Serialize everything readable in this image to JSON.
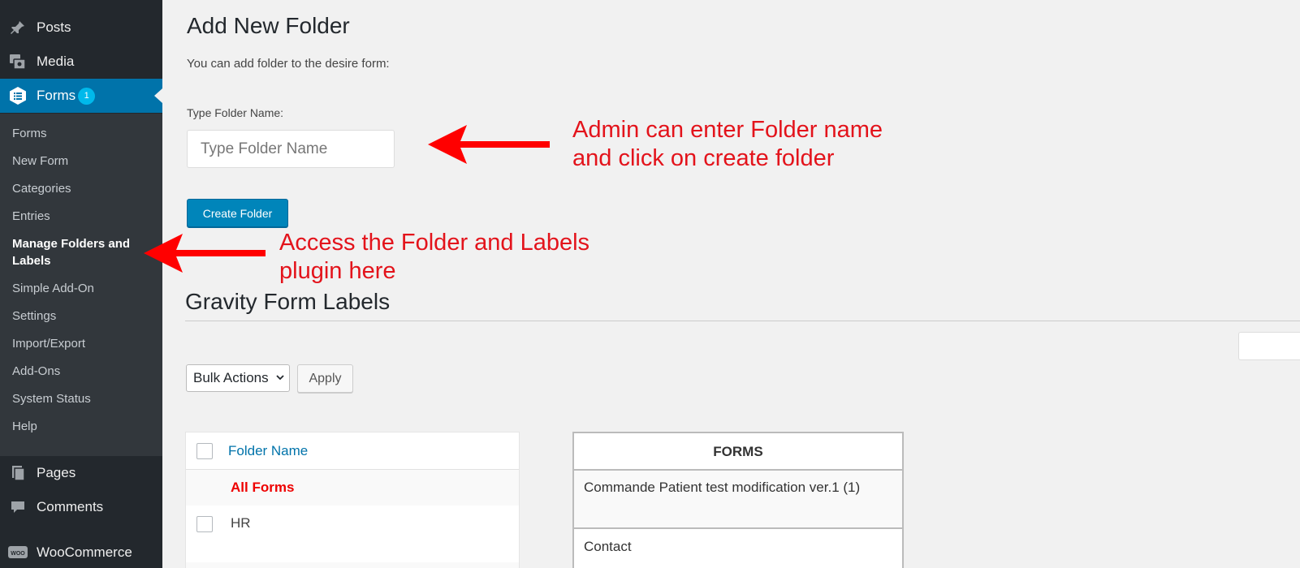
{
  "sidebar": {
    "top_items": [
      {
        "label": "Posts",
        "icon": "pin-icon"
      },
      {
        "label": "Media",
        "icon": "media-icon"
      },
      {
        "label": "Forms",
        "icon": "forms-icon",
        "badge": "1"
      }
    ],
    "submenu": [
      "Forms",
      "New Form",
      "Categories",
      "Entries",
      "Manage Folders and Labels",
      "Simple Add-On",
      "Settings",
      "Import/Export",
      "Add-Ons",
      "System Status",
      "Help"
    ],
    "bottom_items": [
      {
        "label": "Pages",
        "icon": "pages-icon"
      },
      {
        "label": "Comments",
        "icon": "comments-icon"
      },
      {
        "label": "WooCommerce",
        "icon": "woocommerce-icon",
        "icon_text": "WOO"
      }
    ]
  },
  "main": {
    "title": "Add New Folder",
    "description": "You can add folder to the desire form:",
    "folder_label": "Type Folder Name:",
    "folder_placeholder": "Type Folder Name",
    "create_button": "Create Folder",
    "section_title": "Gravity Form Labels",
    "bulk_actions": "Bulk Actions",
    "apply_button": "Apply",
    "folders_table": {
      "header": "Folder Name",
      "all_forms": "All Forms",
      "rows": [
        "HR"
      ]
    },
    "forms_table": {
      "header": "FORMS",
      "rows": [
        "Commande Patient test modification ver.1 (1)",
        "Contact"
      ]
    }
  },
  "annotations": {
    "note1_line1": "Admin can enter Folder name",
    "note1_line2": "and click on create folder",
    "note2_line1": "Access the Folder and Labels",
    "note2_line2": "plugin here",
    "color": "#e3131b"
  },
  "colors": {
    "sidebar_bg": "#23282d",
    "submenu_bg": "#32373c",
    "accent": "#0073aa",
    "badge": "#00b9eb"
  }
}
